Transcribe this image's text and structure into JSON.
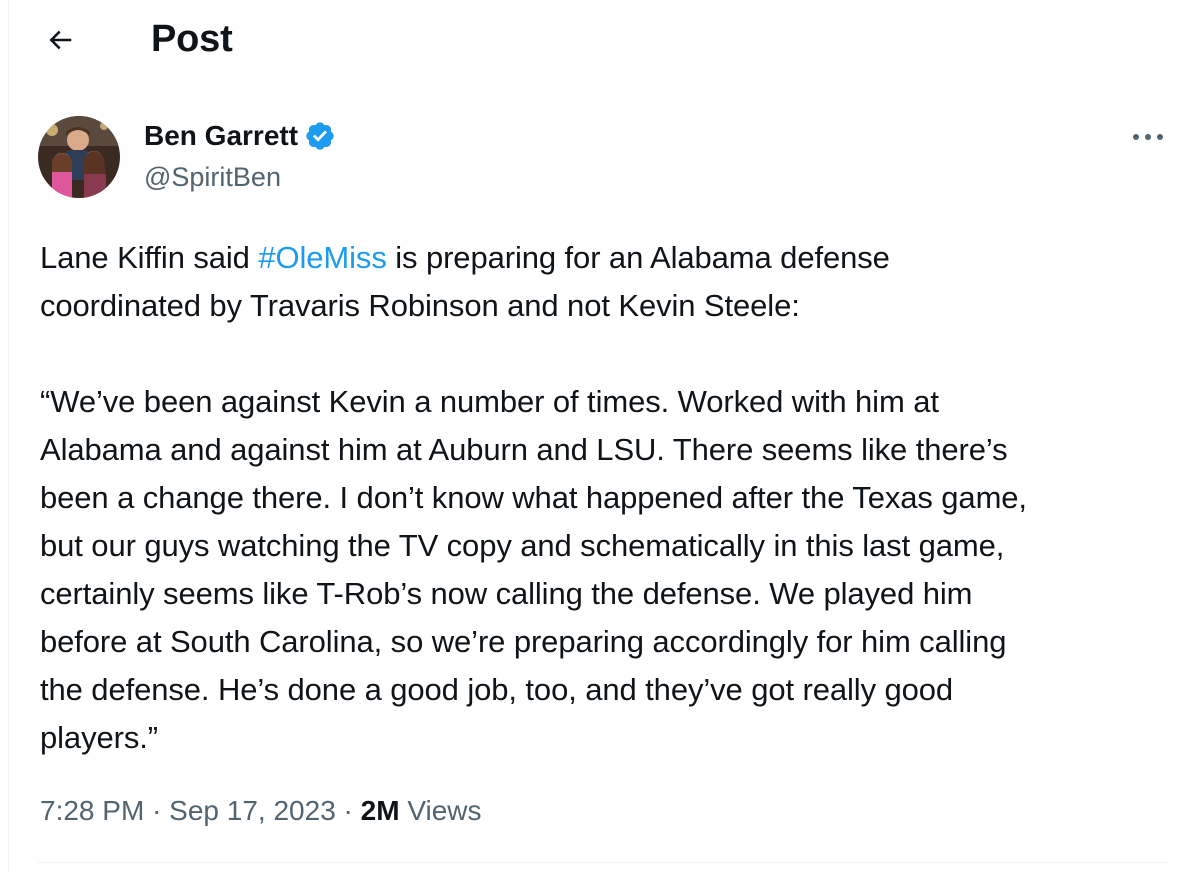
{
  "header": {
    "title": "Post",
    "back_icon": "arrow-left-icon"
  },
  "author": {
    "display_name": "Ben Garrett",
    "handle": "@SpiritBen",
    "verified": true,
    "verified_color": "#1d9bf0",
    "avatar_icon": "profile-photo"
  },
  "more_icon": "more-horizontal-icon",
  "tweet": {
    "text_before": "Lane Kiffin said ",
    "hashtag": "#OleMiss",
    "text_after": " is preparing for an Alabama defense\ncoordinated by Travaris Robinson and not Kevin Steele:\n\n“We’ve been against Kevin a number of times. Worked with him at\nAlabama and against him at Auburn and LSU. There seems like there’s\nbeen a change there. I don’t know what happened after the Texas game,\nbut our guys watching the TV copy and schematically in this last game,\ncertainly seems like T-Rob’s now calling the defense. We played him\nbefore at South Carolina, so we’re preparing accordingly for him calling\nthe defense. He’s done a good job, too, and they’ve got really good\nplayers.”",
    "hashtag_color": "#1d9bf0"
  },
  "meta": {
    "time": "7:28 PM",
    "separator": " · ",
    "date": "Sep 17, 2023",
    "views_count": "2M",
    "views_label": " Views"
  },
  "colors": {
    "text_primary": "#0f1419",
    "text_secondary": "#536471",
    "divider": "#eff3f4"
  }
}
